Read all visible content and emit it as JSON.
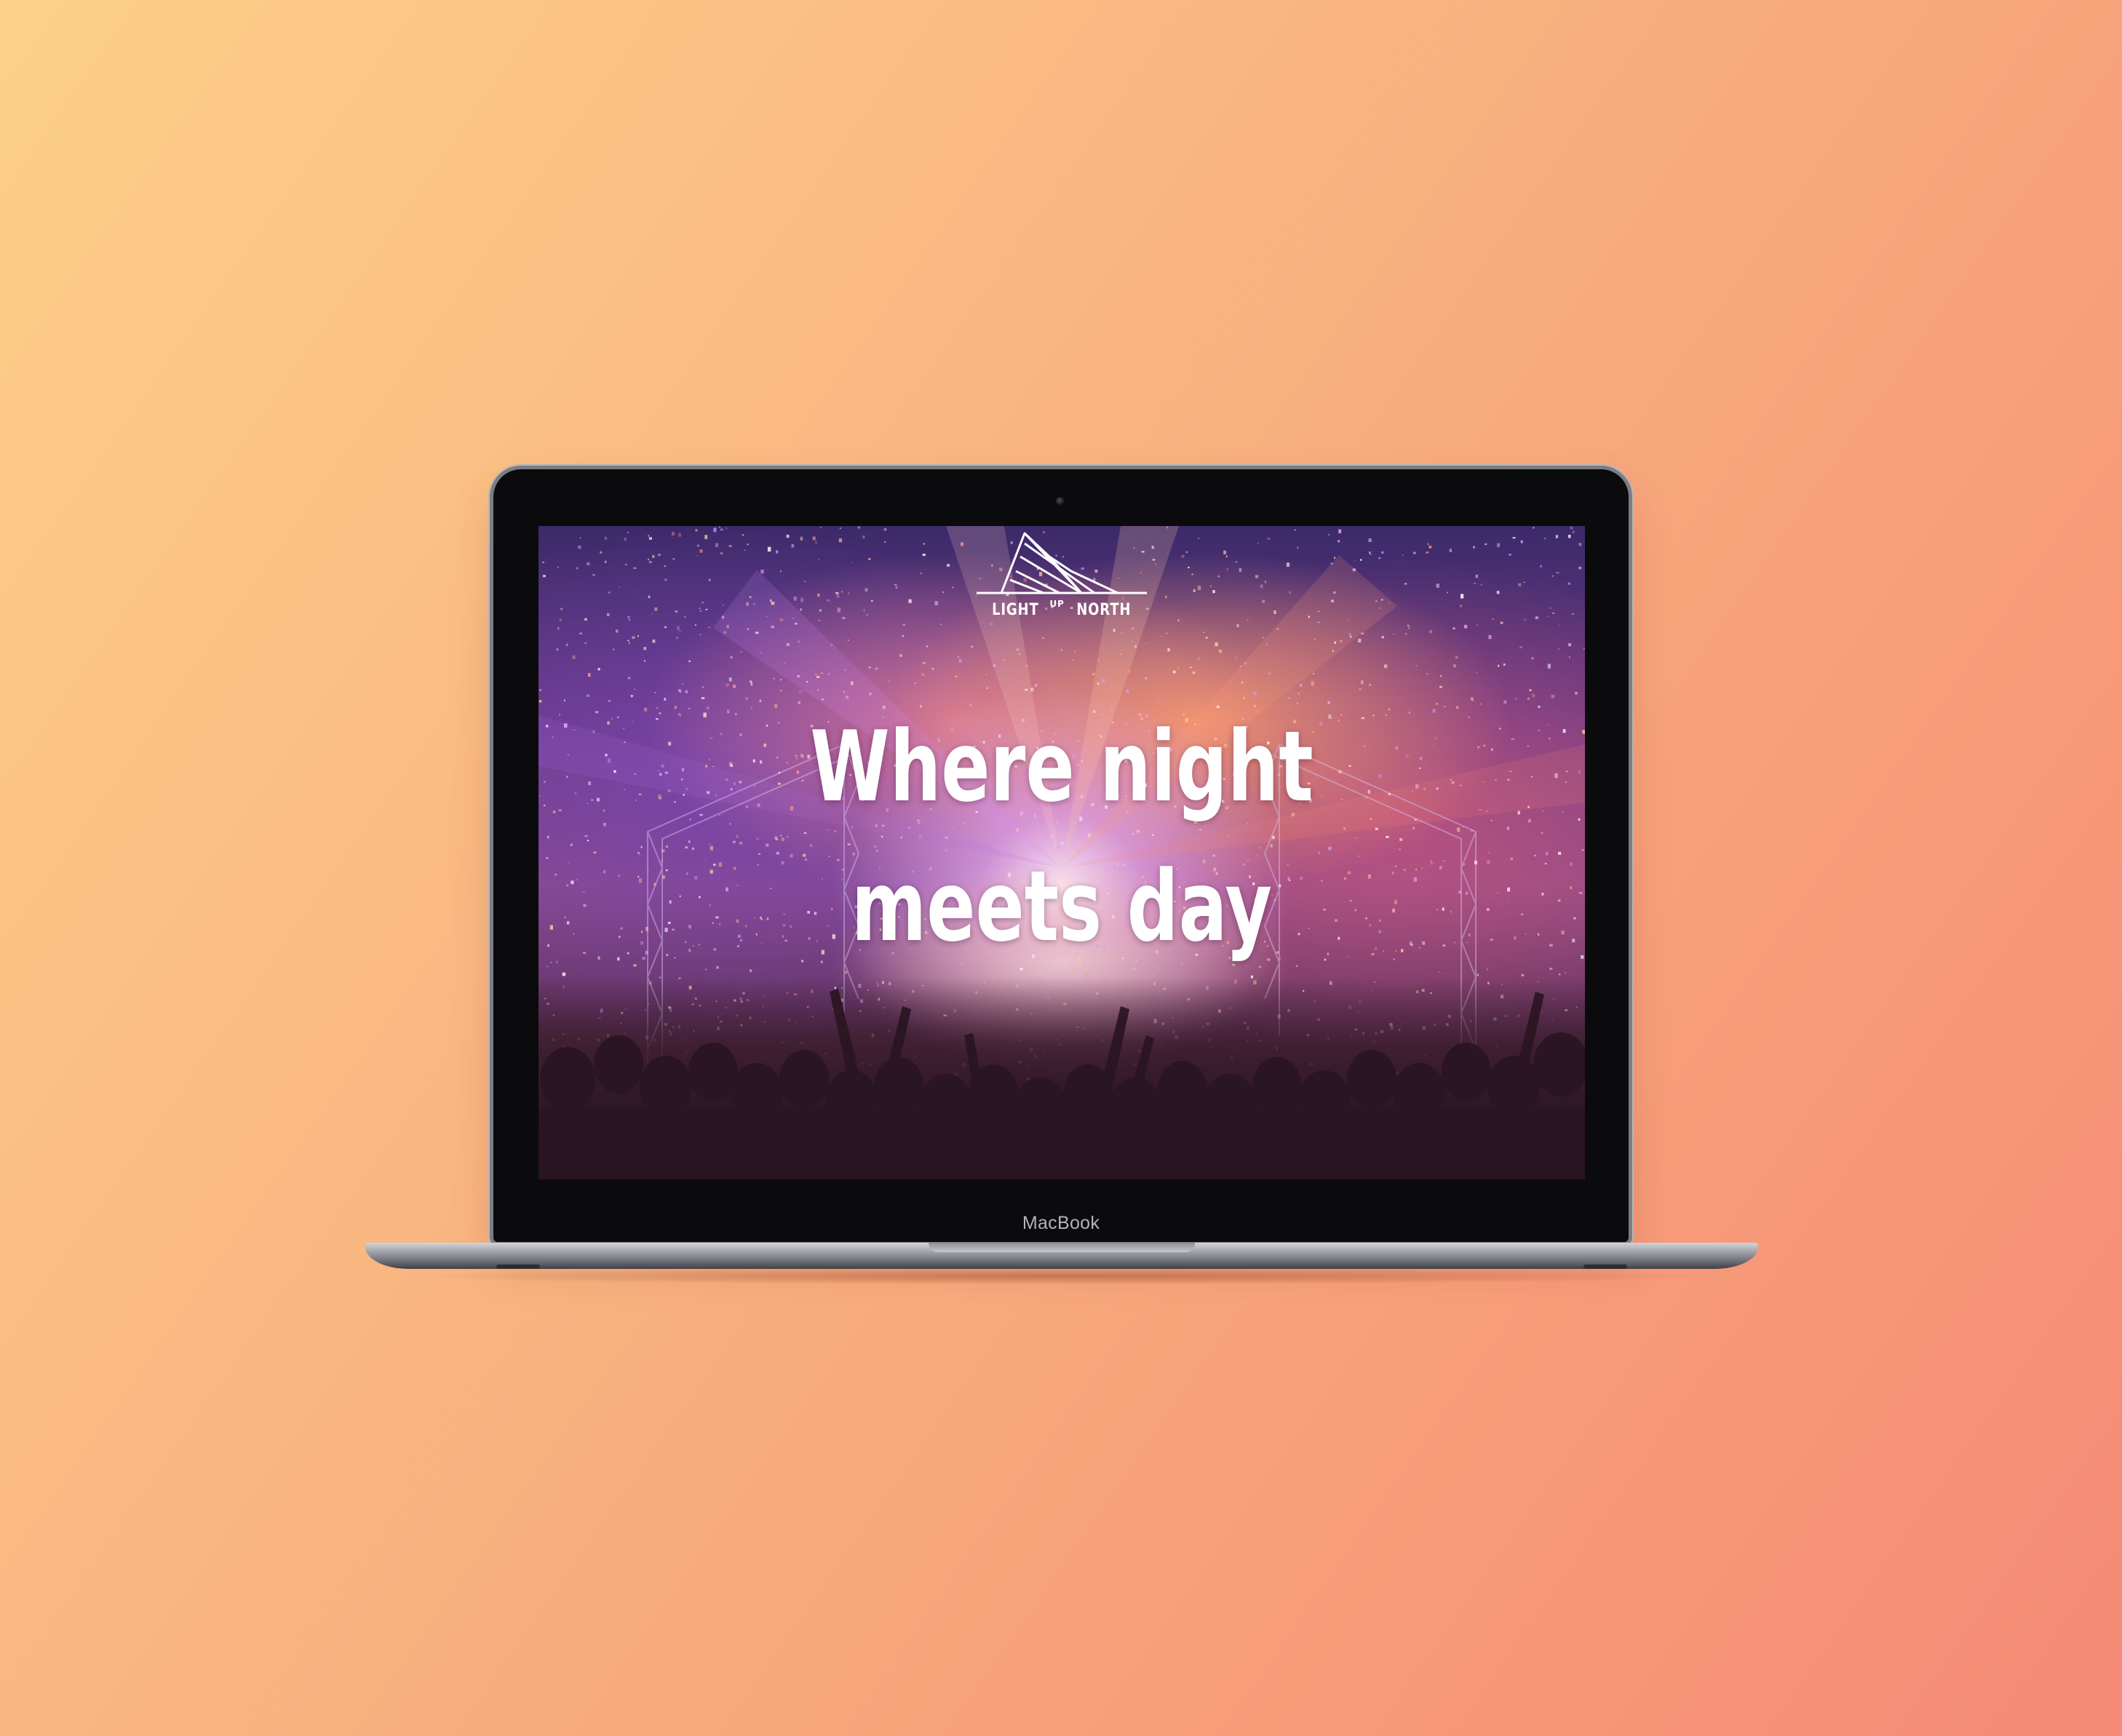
{
  "device": {
    "label": "MacBook"
  },
  "website": {
    "logo": {
      "word_left": "LIGHT",
      "word_sup": "UP",
      "word_right": "NORTH",
      "icon": "mountain-triangle-logo-icon"
    },
    "headline": {
      "line1": "Where night",
      "line2": "meets day"
    },
    "hero_image": "concert-crowd-confetti-stage-photo"
  },
  "colors": {
    "background_start": "#fdd088",
    "background_end": "#f58a76",
    "headline_text": "#ffffff",
    "laptop_body": "#0b0b0d"
  }
}
